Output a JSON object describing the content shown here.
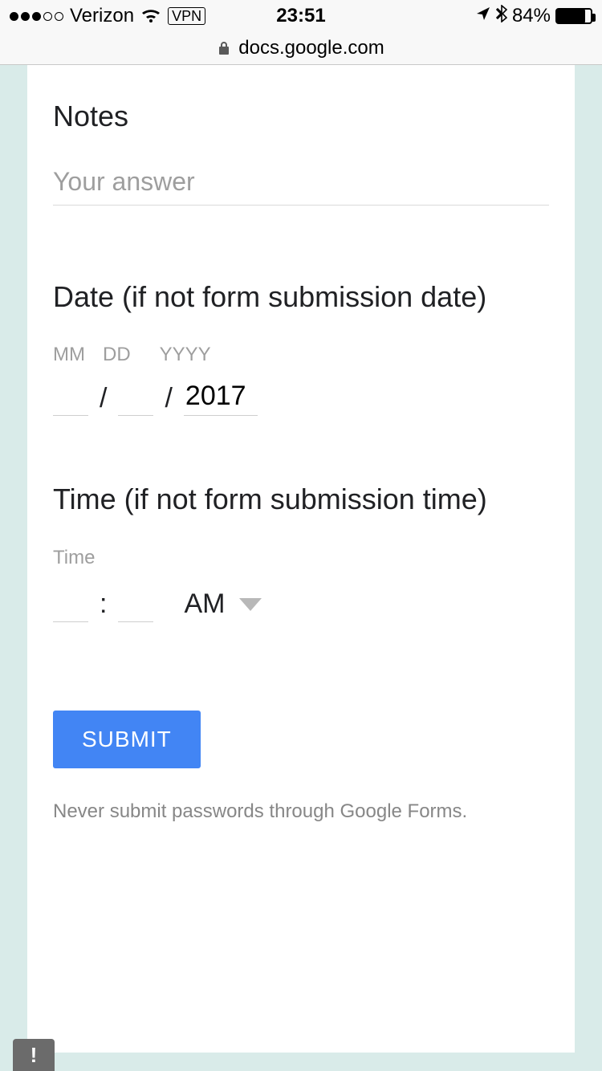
{
  "status": {
    "carrier": "Verizon",
    "vpn": "VPN",
    "time": "23:51",
    "battery_pct": "84%"
  },
  "browser": {
    "domain": "docs.google.com"
  },
  "form": {
    "notes": {
      "title": "Notes",
      "placeholder": "Your answer"
    },
    "date": {
      "title": "Date (if not form submission date)",
      "mm_label": "MM",
      "dd_label": "DD",
      "yyyy_label": "YYYY",
      "year_value": "2017"
    },
    "time": {
      "title": "Time (if not form submission time)",
      "label": "Time",
      "ampm": "AM"
    },
    "submit_label": "SUBMIT",
    "disclaimer": "Never submit passwords through Google Forms."
  },
  "feedback": {
    "mark": "!"
  }
}
